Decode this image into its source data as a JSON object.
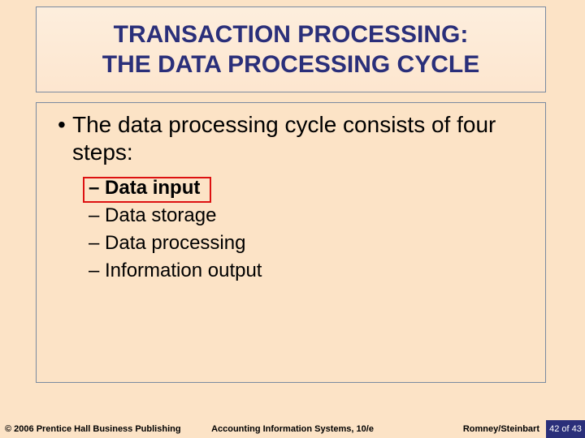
{
  "title": {
    "line1": "TRANSACTION PROCESSING:",
    "line2": "THE DATA PROCESSING CYCLE"
  },
  "main": {
    "bullet": "The data processing cycle consists of four steps:",
    "steps": {
      "s1": "– Data input",
      "s2": "– Data storage",
      "s3": "– Data processing",
      "s4": "– Information output"
    }
  },
  "footer": {
    "copyright": "© 2006 Prentice Hall Business Publishing",
    "book": "Accounting Information Systems, 10/e",
    "authors": "Romney/Steinbart",
    "page": "42 of 43"
  }
}
